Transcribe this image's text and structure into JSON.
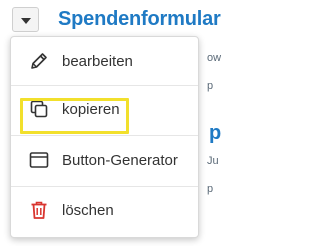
{
  "page": {
    "title": "Spendenformular",
    "bg_texts": [
      "ow",
      "p",
      "Ju",
      "p"
    ],
    "bg_heading": "p"
  },
  "dropdown": {
    "items": [
      {
        "label": "bearbeiten",
        "icon": "pencil-icon"
      },
      {
        "label": "kopieren",
        "icon": "copy-icon"
      },
      {
        "label": "Button-Generator",
        "icon": "window-icon"
      },
      {
        "label": "löschen",
        "icon": "trash-icon"
      }
    ],
    "highlighted_item": "kopieren"
  },
  "colors": {
    "title": "#1f7ac4",
    "highlight": "#f2e02c",
    "delete_icon": "#d9352f",
    "text": "#333333"
  }
}
